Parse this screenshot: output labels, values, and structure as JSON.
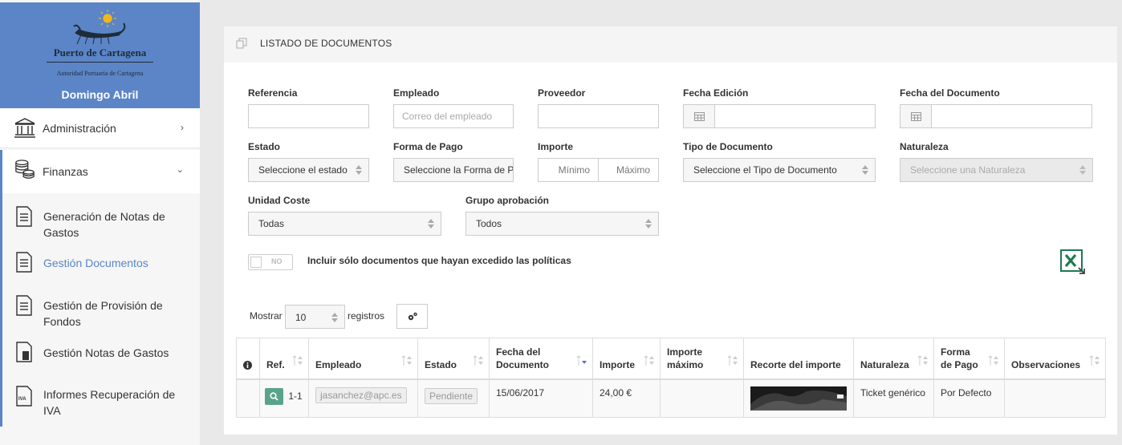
{
  "sidebar": {
    "logo_title": "Puerto de Cartagena",
    "logo_subtitle": "Autoridad Portuaria de Cartagena",
    "user_name": "Domingo Abril",
    "admin_label": "Administración",
    "finance_label": "Finanzas",
    "items": [
      {
        "label": "Generación de Notas de Gastos"
      },
      {
        "label": "Gestión Documentos"
      },
      {
        "label": "Gestión de Provisión de Fondos"
      },
      {
        "label": "Gestión Notas de Gastos"
      },
      {
        "label": "Informes Recuperación de IVA"
      }
    ],
    "active_color": "#5b85c7"
  },
  "panel": {
    "title": "LISTADO DE DOCUMENTOS"
  },
  "filters": {
    "referencia_label": "Referencia",
    "empleado_label": "Empleado",
    "empleado_placeholder": "Correo del empleado",
    "proveedor_label": "Proveedor",
    "fecha_edicion_label": "Fecha Edición",
    "fecha_documento_label": "Fecha del Documento",
    "estado_label": "Estado",
    "estado_value": "Seleccione el estado",
    "forma_pago_label": "Forma de Pago",
    "forma_pago_value": "Seleccione la Forma de Pago",
    "importe_label": "Importe",
    "importe_min_placeholder": "Mínimo",
    "importe_max_placeholder": "Máximo",
    "tipo_documento_label": "Tipo de Documento",
    "tipo_documento_value": "Seleccione el Tipo de Documento",
    "naturaleza_label": "Naturaleza",
    "naturaleza_value": "Seleccione una Naturaleza",
    "unidad_coste_label": "Unidad Coste",
    "unidad_coste_value": "Todas",
    "grupo_aprobacion_label": "Grupo aprobación",
    "grupo_aprobacion_value": "Todos",
    "toggle_state": "NO",
    "toggle_label": "Incluir sólo documentos que hayan excedido las políticas"
  },
  "pager": {
    "show_label": "Mostrar",
    "show_value": "10",
    "records_label": "registros"
  },
  "table": {
    "columns": [
      "Ref.",
      "Empleado",
      "Estado",
      "Fecha del Documento",
      "Importe",
      "Importe máximo",
      "Recorte del importe",
      "Naturaleza",
      "Forma de Pago",
      "Observaciones"
    ],
    "rows": [
      {
        "ref": "1-1",
        "empleado": "jasanchez@apc.es",
        "estado": "Pendiente",
        "fecha": "15/06/2017",
        "importe": "24,00 €",
        "importe_maximo": "",
        "naturaleza": "Ticket genérico",
        "forma_pago": "Por Defecto",
        "observaciones": ""
      }
    ]
  },
  "colors": {
    "brand": "#5b85c7",
    "view_button": "#5aa38b",
    "excel": "#1d7a52"
  },
  "icons": [
    "building-icon",
    "coins-icon",
    "chevron-right-icon",
    "chevron-down-icon",
    "document-icon",
    "document-chart-icon",
    "iva-document-icon",
    "copy-icon",
    "calendar-icon",
    "excel-export-icon",
    "settings-icon",
    "info-icon",
    "search-icon",
    "sort-icon"
  ]
}
